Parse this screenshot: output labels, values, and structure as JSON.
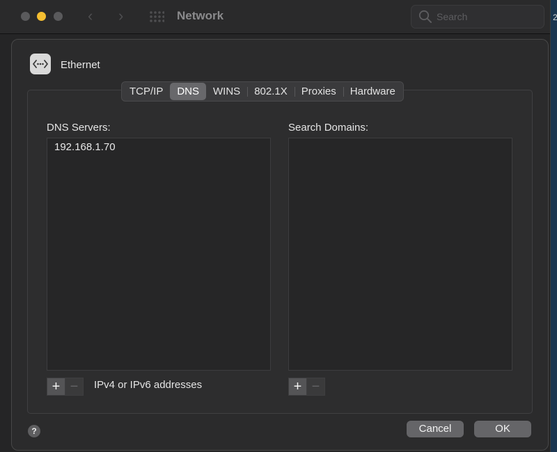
{
  "window": {
    "title": "Network",
    "search_placeholder": "Search",
    "edge_fragment": "2"
  },
  "interface": {
    "name": "Ethernet",
    "icon": "ethernet-icon"
  },
  "tabs": [
    {
      "label": "TCP/IP",
      "active": false
    },
    {
      "label": "DNS",
      "active": true
    },
    {
      "label": "WINS",
      "active": false
    },
    {
      "label": "802.1X",
      "active": false
    },
    {
      "label": "Proxies",
      "active": false
    },
    {
      "label": "Hardware",
      "active": false
    }
  ],
  "dns": {
    "servers_label": "DNS Servers:",
    "servers": [
      "192.168.1.70"
    ],
    "hint": "IPv4 or IPv6 addresses",
    "add": "+",
    "remove": "−"
  },
  "search_domains": {
    "label": "Search Domains:",
    "domains": [],
    "add": "+",
    "remove": "−"
  },
  "footer": {
    "help": "?",
    "cancel": "Cancel",
    "ok": "OK"
  },
  "colors": {
    "minimize_light": "#f5be31",
    "active_tab": "#68686b",
    "background": "#252526"
  }
}
